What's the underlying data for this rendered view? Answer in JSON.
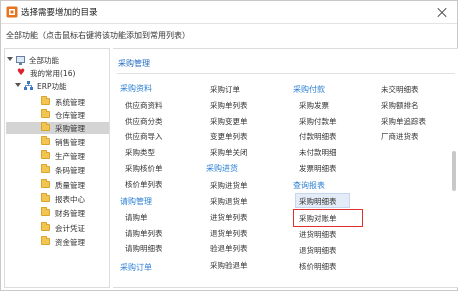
{
  "window": {
    "title": "选择需要增加的目录",
    "hint": "全部功能（点击鼠标右键将该功能添加到常用列表）"
  },
  "tree": {
    "root_label": "全部功能",
    "favorites_label": "我的常用(16)",
    "erp_label": "ERP功能",
    "items": [
      {
        "label": "系统管理"
      },
      {
        "label": "仓库管理"
      },
      {
        "label": "采购管理"
      },
      {
        "label": "销售管理"
      },
      {
        "label": "生产管理"
      },
      {
        "label": "条码管理"
      },
      {
        "label": "质量管理"
      },
      {
        "label": "报表中心"
      },
      {
        "label": "财务管理"
      },
      {
        "label": "会计凭证"
      },
      {
        "label": "资金管理"
      }
    ],
    "selected": "采购管理"
  },
  "right": {
    "header": "采购管理",
    "col1": {
      "cat_purchase_data": "采购资料",
      "items_data": [
        "供应商资料",
        "供应商分类",
        "供应商导入",
        "采购类型",
        "采购核价单",
        "核价单列表"
      ],
      "cat_request": "请购管理",
      "items_request": [
        "请购单",
        "请购单列表",
        "请购明细表"
      ],
      "cat_order": "采购订单"
    },
    "col2": {
      "items_order": [
        "采购订单",
        "采购单列表",
        "采购变更单",
        "变更单列表",
        "采购单关闭"
      ],
      "cat_inbound": "采购进货",
      "items_inbound": [
        "采购进货单",
        "采购退货单",
        "进货单列表",
        "退货单列表",
        "验退单列表",
        "采购验退单"
      ]
    },
    "col3": {
      "cat_payment": "采购付款",
      "items_payment": [
        "采购发票",
        "采购付款单",
        "付款明细表",
        "未付款明细",
        "发票明细表"
      ],
      "cat_query": "查询报表",
      "items_query": [
        "采购明细表",
        "采购对账单",
        "进货明细表",
        "退货明细表",
        "核价明细表"
      ],
      "highlighted": "采购明细表",
      "boxed": "采购对账单"
    },
    "col4": {
      "items": [
        "未交明细表",
        "采购额排名",
        "采购单追踪表",
        "厂商进货表"
      ]
    }
  },
  "colors": {
    "link_blue": "#2a7fd4",
    "header_blue": "#1f6bc1",
    "selected_bg": "#d4d4d4",
    "highlight_bg": "#e4ecf7",
    "box_red": "#e0312f"
  }
}
